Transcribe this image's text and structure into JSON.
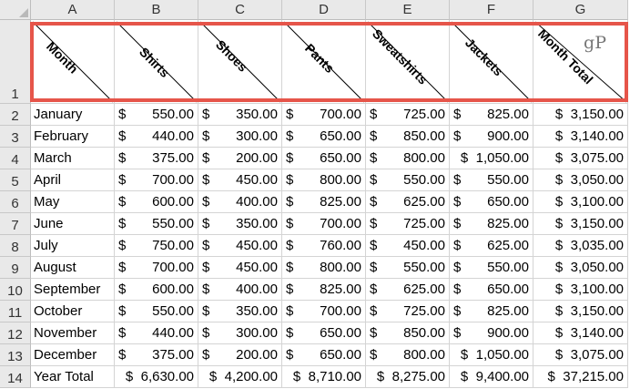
{
  "column_letters": [
    "A",
    "B",
    "C",
    "D",
    "E",
    "F",
    "G"
  ],
  "row_numbers": [
    "1",
    "2",
    "3",
    "4",
    "5",
    "6",
    "7",
    "8",
    "9",
    "10",
    "11",
    "12",
    "13",
    "14"
  ],
  "headers": [
    "Month",
    "Shirts",
    "Shoes",
    "Pants",
    "Sweatshirts",
    "Jackets",
    "Month Total"
  ],
  "watermark": "gP",
  "currency_symbol": "$",
  "rows": [
    {
      "month": "January",
      "values": [
        "550.00",
        "350.00",
        "700.00",
        "725.00",
        "825.00",
        "3,150.00"
      ]
    },
    {
      "month": "February",
      "values": [
        "440.00",
        "300.00",
        "650.00",
        "850.00",
        "900.00",
        "3,140.00"
      ]
    },
    {
      "month": "March",
      "values": [
        "375.00",
        "200.00",
        "650.00",
        "800.00",
        "1,050.00",
        "3,075.00"
      ]
    },
    {
      "month": "April",
      "values": [
        "700.00",
        "450.00",
        "800.00",
        "550.00",
        "550.00",
        "3,050.00"
      ]
    },
    {
      "month": "May",
      "values": [
        "600.00",
        "400.00",
        "825.00",
        "625.00",
        "650.00",
        "3,100.00"
      ]
    },
    {
      "month": "June",
      "values": [
        "550.00",
        "350.00",
        "700.00",
        "725.00",
        "825.00",
        "3,150.00"
      ]
    },
    {
      "month": "July",
      "values": [
        "750.00",
        "450.00",
        "760.00",
        "450.00",
        "625.00",
        "3,035.00"
      ]
    },
    {
      "month": "August",
      "values": [
        "700.00",
        "450.00",
        "800.00",
        "550.00",
        "550.00",
        "3,050.00"
      ]
    },
    {
      "month": "September",
      "values": [
        "600.00",
        "400.00",
        "825.00",
        "625.00",
        "650.00",
        "3,100.00"
      ]
    },
    {
      "month": "October",
      "values": [
        "550.00",
        "350.00",
        "700.00",
        "725.00",
        "825.00",
        "3,150.00"
      ]
    },
    {
      "month": "November",
      "values": [
        "440.00",
        "300.00",
        "650.00",
        "850.00",
        "900.00",
        "3,140.00"
      ]
    },
    {
      "month": "December",
      "values": [
        "375.00",
        "200.00",
        "650.00",
        "800.00",
        "1,050.00",
        "3,075.00"
      ]
    },
    {
      "month": "Year Total",
      "values": [
        "6,630.00",
        "4,200.00",
        "8,710.00",
        "8,275.00",
        "9,400.00",
        "37,215.00"
      ]
    }
  ],
  "highlight_color": "#e6554a"
}
